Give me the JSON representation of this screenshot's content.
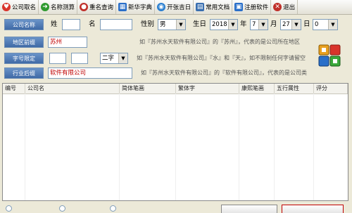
{
  "toolbar": {
    "items": [
      {
        "label": "公司取名",
        "icon": "heart-icon",
        "color": "#d9342b"
      },
      {
        "label": "名称测算",
        "icon": "arrow-right-icon",
        "color": "#2f9a2f"
      },
      {
        "label": "重名查询",
        "icon": "person-icon",
        "color": "#c0302a"
      },
      {
        "label": "新华字典",
        "icon": "windows-flag-icon",
        "color": "#2a6fc9"
      },
      {
        "label": "开张吉日",
        "icon": "globe-icon",
        "color": "#2b7fd0"
      },
      {
        "label": "常用文档",
        "icon": "document-icon",
        "color": "#3a6fb0"
      },
      {
        "label": "注册软件",
        "icon": "register-doc-icon",
        "color": "#2a6fc9"
      },
      {
        "label": "退出",
        "icon": "close-x-icon",
        "color": "#c0302a"
      }
    ]
  },
  "form": {
    "row1": {
      "button": "公司名称",
      "surname_label": "姓",
      "surname_value": "",
      "name_label": "名",
      "name_value": "",
      "gender_label": "性别",
      "gender_value": "男",
      "birth_label": "生日",
      "year_value": "2018",
      "year_unit": "年",
      "month_value": "7",
      "month_unit": "月",
      "day_value": "27",
      "day_unit": "日",
      "hour_value": "0"
    },
    "row2": {
      "button": "地区前缀",
      "value": "苏州",
      "hint": "如『苏州水天软件有限公司』的『苏州』，代表的是公司所在地区"
    },
    "row3": {
      "button": "字号限定",
      "char1": "",
      "char2": "",
      "char_count": "二字",
      "hint": "如『苏州水天软件有限公司』『水』和『天』，如不限制任何字请留空"
    },
    "row4": {
      "button": "行业后缀",
      "value": "软件有限公司",
      "hint": "如『苏州水天软件有限公司』的『软件有限公司』，代表的是公司类"
    }
  },
  "table": {
    "columns": [
      "编号",
      "公司名",
      "简体笔画",
      "繁体字",
      "康熙笔画",
      "五行属性",
      "评分"
    ]
  },
  "colors": {
    "accent_blue": "#3f6aa6",
    "red_text": "#c00000",
    "window_bg": "#ece9d8"
  }
}
